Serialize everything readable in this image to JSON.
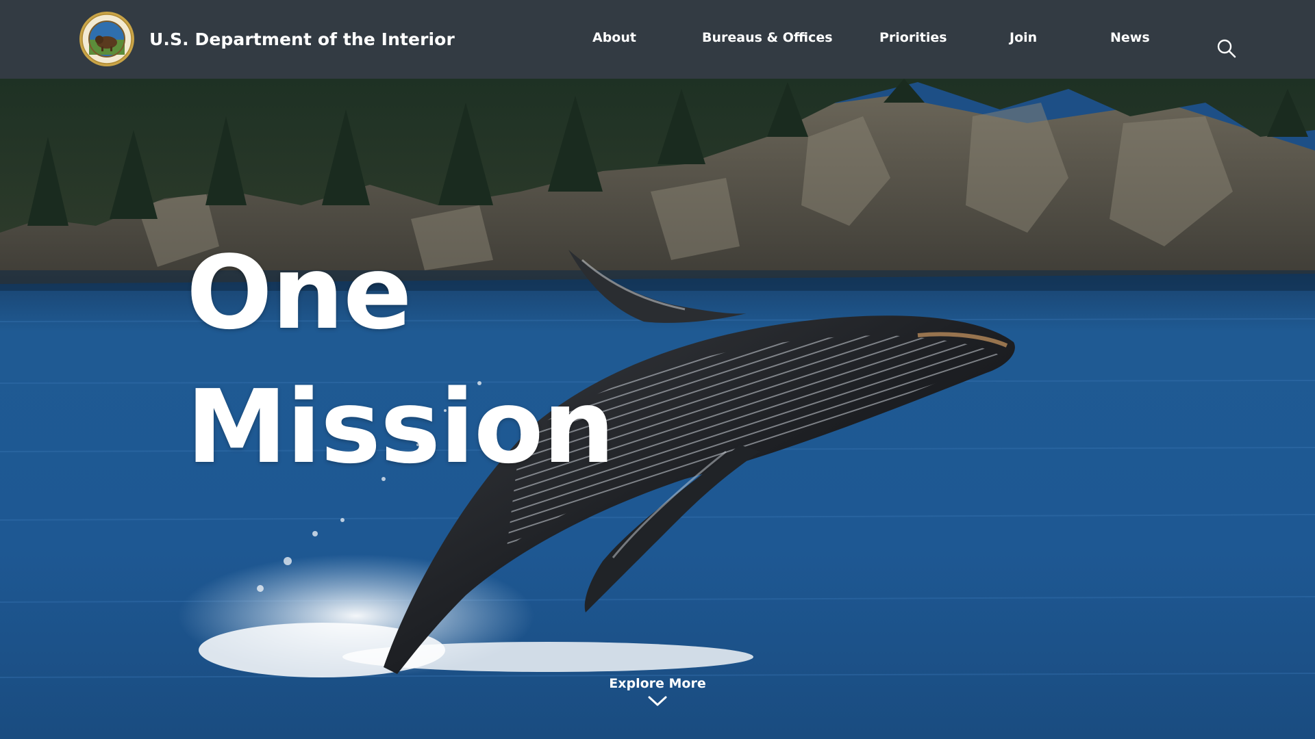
{
  "header": {
    "site_title": "U.S. Department of the Interior",
    "logo_icon": "doi-seal-icon",
    "background_color": "#333b43"
  },
  "nav": {
    "items": [
      {
        "label": "About"
      },
      {
        "label": "Bureaus & Offices"
      },
      {
        "label": "Priorities"
      },
      {
        "label": "Join"
      },
      {
        "label": "News"
      }
    ],
    "search_icon": "search-icon"
  },
  "hero": {
    "headline_line1": "One",
    "headline_line2": "Mission",
    "image_subject": "humpback whale breaching in front of forested rocky cliffs",
    "explore_label": "Explore More",
    "explore_icon": "chevron-down-icon"
  }
}
